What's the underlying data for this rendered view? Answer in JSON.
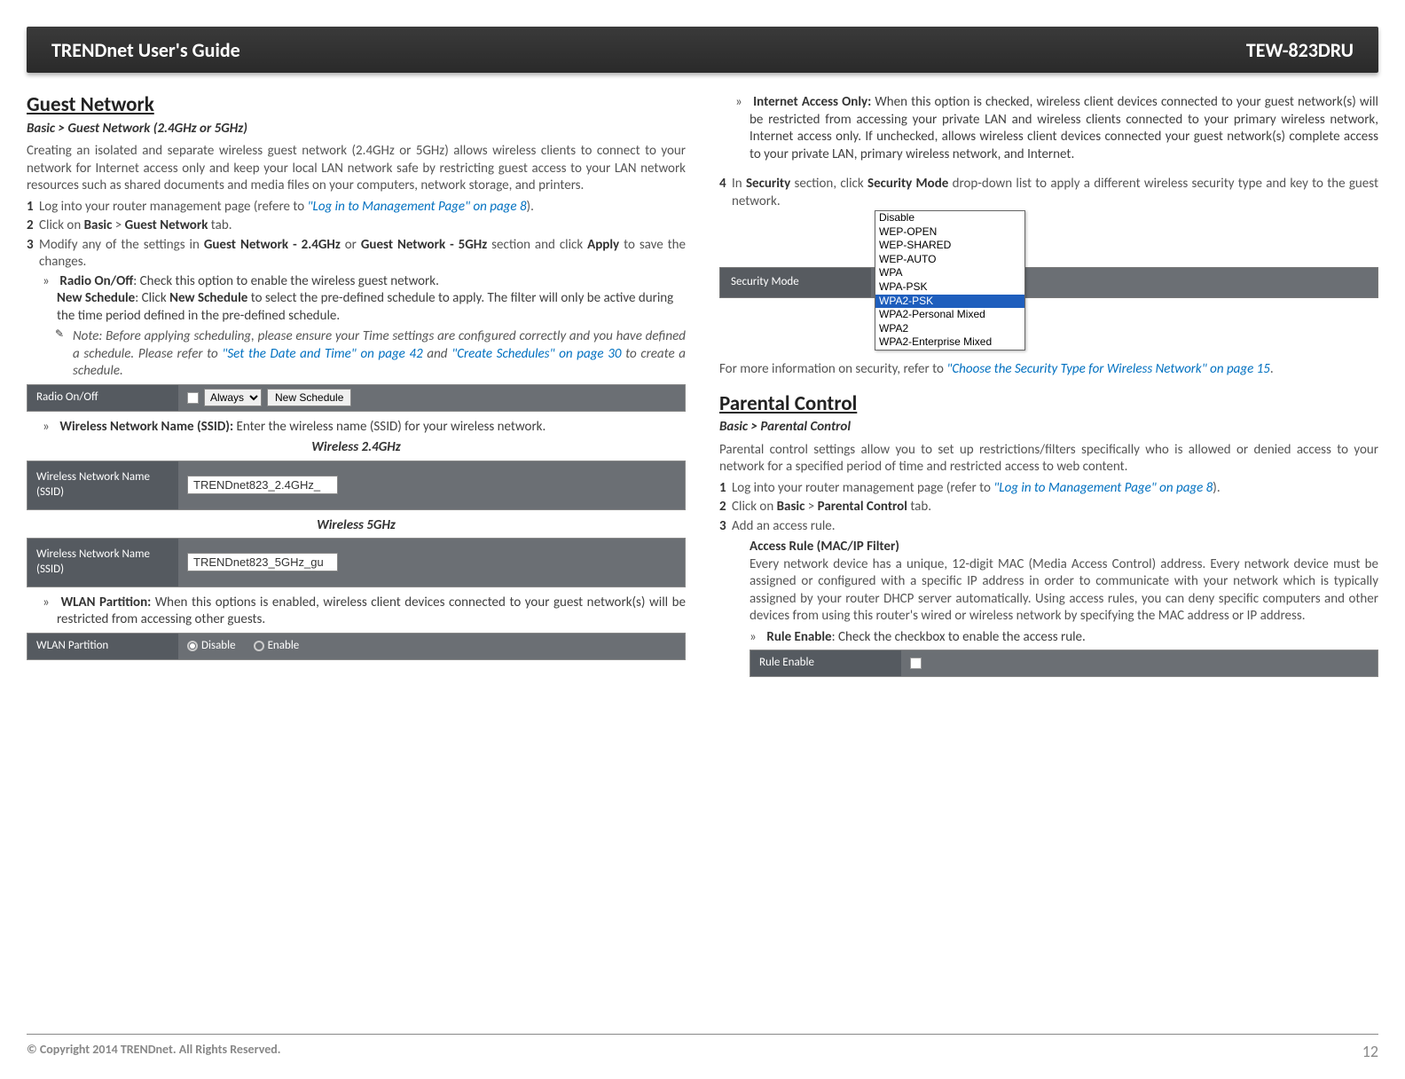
{
  "header": {
    "left": "TRENDnet User's Guide",
    "right": "TEW-823DRU"
  },
  "left": {
    "h1": "Guest Network",
    "breadcrumb": "Basic > Guest Network (2.4GHz or 5GHz)",
    "intro": "Creating an isolated and separate wireless guest network (2.4GHz or 5GHz) allows wireless clients to connect to your network for Internet access only and keep your local LAN network safe by restricting guest access to your LAN network resources such as shared documents and media files on your computers, network storage, and printers.",
    "step1a": "Log into your router management page (refere to ",
    "step1link": "\"Log in to Management Page\" on page 8",
    "step1b": ").",
    "step2a": "Click on ",
    "step2b": "Basic",
    "step2c": " > ",
    "step2d": "Guest Network",
    "step2e": " tab.",
    "step3a": "Modify any of the settings in ",
    "step3b": "Guest Network - 2.4GHz",
    "step3c": " or ",
    "step3d": "Guest Network - 5GHz",
    "step3e": " section and click ",
    "step3f": "Apply",
    "step3g": " to save the changes.",
    "radio_t": "Radio On/Off",
    "radio_d": ": Check this option to enable the wireless guest network.",
    "newsched_t": "New Schedule",
    "newsched_d1": ": Click ",
    "newsched_d2": "New Schedule",
    "newsched_d3": " to select the pre-defined schedule to apply. The filter will only be active during the time period defined in the pre-defined schedule.",
    "note_a": "Note: Before applying scheduling, please ensure your Time settings are configured correctly and you have defined a schedule. Please refer to ",
    "note_l1": "\"Set the Date and Time\" on page 42",
    "note_b": " and ",
    "note_l2": "\"Create Schedules\" on page 30",
    "note_c": " to create a schedule.",
    "ui_radio_label": "Radio On/Off",
    "ui_radio_sel": "Always",
    "ui_radio_btn": "New Schedule",
    "ssid_t": "Wireless Network Name (SSID):",
    "ssid_d": " Enter the wireless name (SSID) for your wireless network.",
    "cap24": "Wireless 2.4GHz",
    "cap5": "Wireless 5GHz",
    "ui_ssid_label": "Wireless Network Name (SSID)",
    "ui_ssid24_val": "TRENDnet823_2.4GHz_",
    "ui_ssid5_val": "TRENDnet823_5GHz_gu",
    "wlan_t": "WLAN Partition:",
    "wlan_d": " When this options is enabled, wireless client devices connected to your guest network(s) will be restricted from accessing other guests.",
    "ui_wlan_label": "WLAN Partition",
    "ui_wlan_disable": "Disable",
    "ui_wlan_enable": "Enable"
  },
  "right": {
    "iao_t": "Internet Access Only:",
    "iao_d": " When this option is checked, wireless client devices connected to your guest network(s) will be restricted from accessing your private LAN and wireless clients connected to your primary wireless network, Internet access only. If unchecked, allows wireless client devices connected your guest network(s) complete access to your private LAN, primary wireless network, and Internet.",
    "step4a": "In ",
    "step4b": "Security",
    "step4c": " section, click ",
    "step4d": "Security Mode",
    "step4e": " drop-down list to apply a different wireless security type and key to the guest network.",
    "sec_label": "Security Mode",
    "sec_opts": [
      "Disable",
      "WEP-OPEN",
      "WEP-SHARED",
      "WEP-AUTO",
      "WPA",
      "WPA-PSK",
      "WPA2-PSK",
      "WPA2-Personal Mixed",
      "WPA2",
      "WPA2-Enterprise Mixed"
    ],
    "moreinfo_a": "For more information on security, refer to ",
    "moreinfo_l": "\"Choose the Security Type for Wireless Network\" on page 15",
    "moreinfo_b": ".",
    "h1": "Parental Control",
    "breadcrumb": "Basic > Parental Control",
    "intro": "Parental control settings allow you to set up restrictions/filters specifically who is allowed or denied access to your network for a specified period of time and restricted access to web content.",
    "p_step1a": "Log into your router management page (refer to ",
    "p_step1l": "\"Log in to Management Page\" on page 8",
    "p_step1b": ").",
    "p_step2a": "Click on ",
    "p_step2b": "Basic",
    "p_step2c": " > ",
    "p_step2d": "Parental Control",
    "p_step2e": " tab.",
    "p_step3": "Add an access rule.",
    "ar_t": "Access Rule (MAC/IP Filter)",
    "ar_d": "Every network device has a unique, 12-digit MAC (Media Access Control) address. Every network device must be assigned or configured with a specific IP address in order to communicate with your network which is typically assigned by your router DHCP server automatically. Using access rules, you can deny specific computers and other devices from using this router's wired or wireless network by specifying the MAC address or IP address.",
    "re_t": "Rule Enable",
    "re_d": ": Check the checkbox to enable the access rule.",
    "ui_re_label": "Rule Enable"
  },
  "footer": {
    "copy": "© Copyright 2014 TRENDnet. All Rights Reserved.",
    "page": "12"
  }
}
